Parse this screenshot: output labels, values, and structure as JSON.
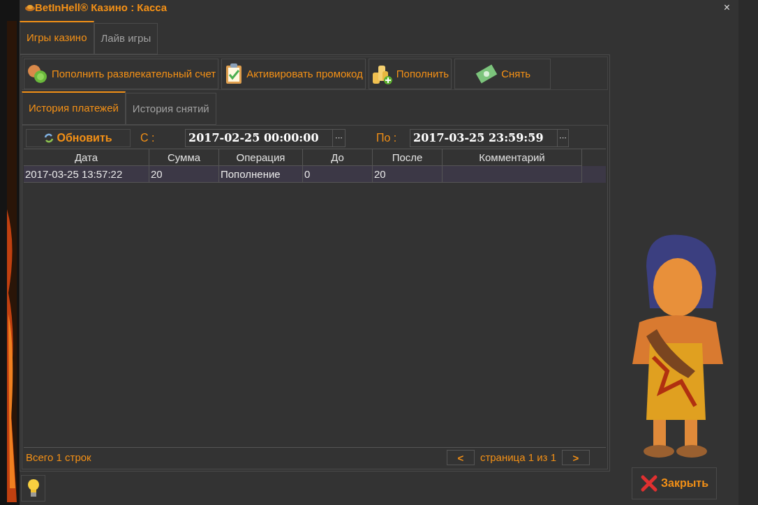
{
  "window": {
    "title": "BetInHell® Казино : Касса",
    "close": "×"
  },
  "tabs": [
    {
      "label": "Игры казино",
      "selected": true
    },
    {
      "label": "Лайв игры",
      "selected": false
    }
  ],
  "actions": [
    {
      "label": "Пополнить развлекательный счет",
      "kind": "coins"
    },
    {
      "label": "Активировать промокод",
      "kind": "clipboard"
    },
    {
      "label": "Пополнить",
      "kind": "stack"
    },
    {
      "label": "Снять",
      "kind": "cash"
    }
  ],
  "subtabs": [
    {
      "label": "История платежей",
      "selected": true
    },
    {
      "label": "История снятий",
      "selected": false
    }
  ],
  "toolbar": {
    "refresh": "Обновить",
    "from_label": "С :",
    "from_value": "2017-02-25 00:00:00",
    "to_label": "По :",
    "to_value": "2017-03-25 23:59:59",
    "picker": "···"
  },
  "table": {
    "columns": [
      "Дата",
      "Сумма",
      "Операция",
      "До",
      "После",
      "Комментарий"
    ],
    "rows": [
      [
        "2017-03-25 13:57:22",
        "20",
        "Пополнение",
        "0",
        "20",
        ""
      ]
    ]
  },
  "footer": {
    "count": "Всего 1 строк",
    "prev": "<",
    "page": "страница 1 из 1",
    "next": ">"
  },
  "close_button": "Закрыть"
}
